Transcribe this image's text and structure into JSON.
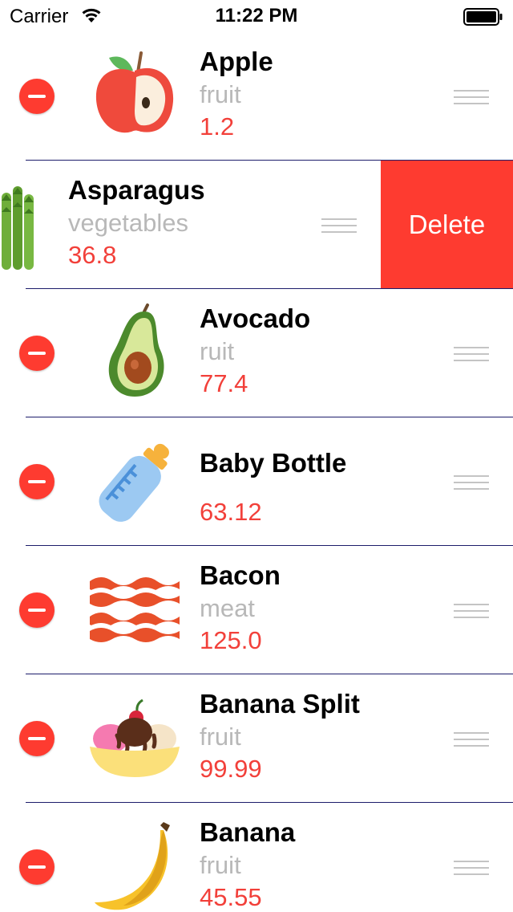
{
  "status_bar": {
    "carrier": "Carrier",
    "time": "11:22 PM",
    "wifi_icon": "wifi-icon",
    "battery_icon": "battery-icon"
  },
  "colors": {
    "destructive": "#fe3b30",
    "value_text": "#f2403a",
    "secondary_text": "#b8b8b8",
    "separator": "#1d1d6b"
  },
  "rows": [
    {
      "name": "Apple",
      "category": "fruit",
      "value": "1.2",
      "icon": "apple-icon"
    },
    {
      "name": "Asparagus",
      "category": "vegetables",
      "value": "36.8",
      "icon": "asparagus-icon",
      "delete_label": "Delete"
    },
    {
      "name": "Avocado",
      "category": "ruit",
      "value": "77.4",
      "icon": "avocado-icon"
    },
    {
      "name": "Baby Bottle",
      "category": "",
      "value": "63.12",
      "icon": "baby-bottle-icon"
    },
    {
      "name": "Bacon",
      "category": "meat",
      "value": "125.0",
      "icon": "bacon-icon"
    },
    {
      "name": "Banana Split",
      "category": "fruit",
      "value": "99.99",
      "icon": "banana-split-icon"
    },
    {
      "name": "Banana",
      "category": "fruit",
      "value": "45.55",
      "icon": "banana-icon"
    }
  ]
}
